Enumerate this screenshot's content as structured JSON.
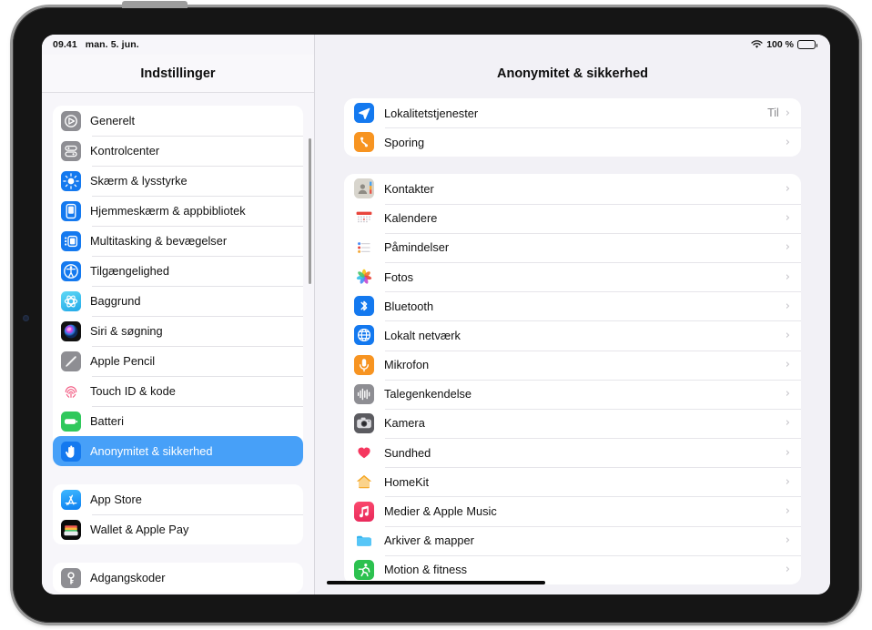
{
  "status_bar": {
    "time": "09.41",
    "date": "man. 5. jun.",
    "battery_percent": "100 %",
    "wifi_icon": "wifi-icon",
    "battery_icon": "battery-full-icon"
  },
  "sidebar": {
    "title": "Indstillinger",
    "groups": [
      {
        "items": [
          {
            "label": "Generelt",
            "icon": "gear-settings-icon",
            "selected": false
          },
          {
            "label": "Kontrolcenter",
            "icon": "control-center-icon",
            "selected": false
          },
          {
            "label": "Skærm & lysstyrke",
            "icon": "brightness-icon",
            "selected": false
          },
          {
            "label": "Hjemmeskærm & appbibliotek",
            "icon": "home-screen-icon",
            "selected": false
          },
          {
            "label": "Multitasking & bevægelser",
            "icon": "multitasking-icon",
            "selected": false
          },
          {
            "label": "Tilgængelighed",
            "icon": "accessibility-icon",
            "selected": false
          },
          {
            "label": "Baggrund",
            "icon": "wallpaper-icon",
            "selected": false
          },
          {
            "label": "Siri & søgning",
            "icon": "siri-icon",
            "selected": false
          },
          {
            "label": "Apple Pencil",
            "icon": "pencil-icon",
            "selected": false
          },
          {
            "label": "Touch ID & kode",
            "icon": "touch-id-icon",
            "selected": false
          },
          {
            "label": "Batteri",
            "icon": "battery-icon",
            "selected": false
          },
          {
            "label": "Anonymitet & sikkerhed",
            "icon": "privacy-hand-icon",
            "selected": true
          }
        ]
      },
      {
        "items": [
          {
            "label": "App Store",
            "icon": "app-store-icon",
            "selected": false
          },
          {
            "label": "Wallet & Apple Pay",
            "icon": "wallet-icon",
            "selected": false
          }
        ]
      },
      {
        "items": [
          {
            "label": "Adgangskoder",
            "icon": "passwords-key-icon",
            "selected": false
          }
        ]
      }
    ]
  },
  "detail": {
    "title": "Anonymitet & sikkerhed",
    "groups": [
      {
        "rows": [
          {
            "label": "Lokalitetstjenester",
            "value": "Til",
            "icon": "location-arrow-icon"
          },
          {
            "label": "Sporing",
            "value": "",
            "icon": "tracking-icon"
          }
        ]
      },
      {
        "rows": [
          {
            "label": "Kontakter",
            "value": "",
            "icon": "contacts-icon"
          },
          {
            "label": "Kalendere",
            "value": "",
            "icon": "calendar-icon"
          },
          {
            "label": "Påmindelser",
            "value": "",
            "icon": "reminders-icon"
          },
          {
            "label": "Fotos",
            "value": "",
            "icon": "photos-icon"
          },
          {
            "label": "Bluetooth",
            "value": "",
            "icon": "bluetooth-icon"
          },
          {
            "label": "Lokalt netværk",
            "value": "",
            "icon": "local-network-icon"
          },
          {
            "label": "Mikrofon",
            "value": "",
            "icon": "microphone-icon"
          },
          {
            "label": "Talegenkendelse",
            "value": "",
            "icon": "speech-recognition-icon"
          },
          {
            "label": "Kamera",
            "value": "",
            "icon": "camera-icon"
          },
          {
            "label": "Sundhed",
            "value": "",
            "icon": "health-heart-icon"
          },
          {
            "label": "HomeKit",
            "value": "",
            "icon": "homekit-icon"
          },
          {
            "label": "Medier & Apple Music",
            "value": "",
            "icon": "apple-music-icon"
          },
          {
            "label": "Arkiver & mapper",
            "value": "",
            "icon": "files-folder-icon"
          },
          {
            "label": "Motion & fitness",
            "value": "",
            "icon": "fitness-icon"
          }
        ]
      }
    ],
    "chevron_glyph": "›"
  }
}
